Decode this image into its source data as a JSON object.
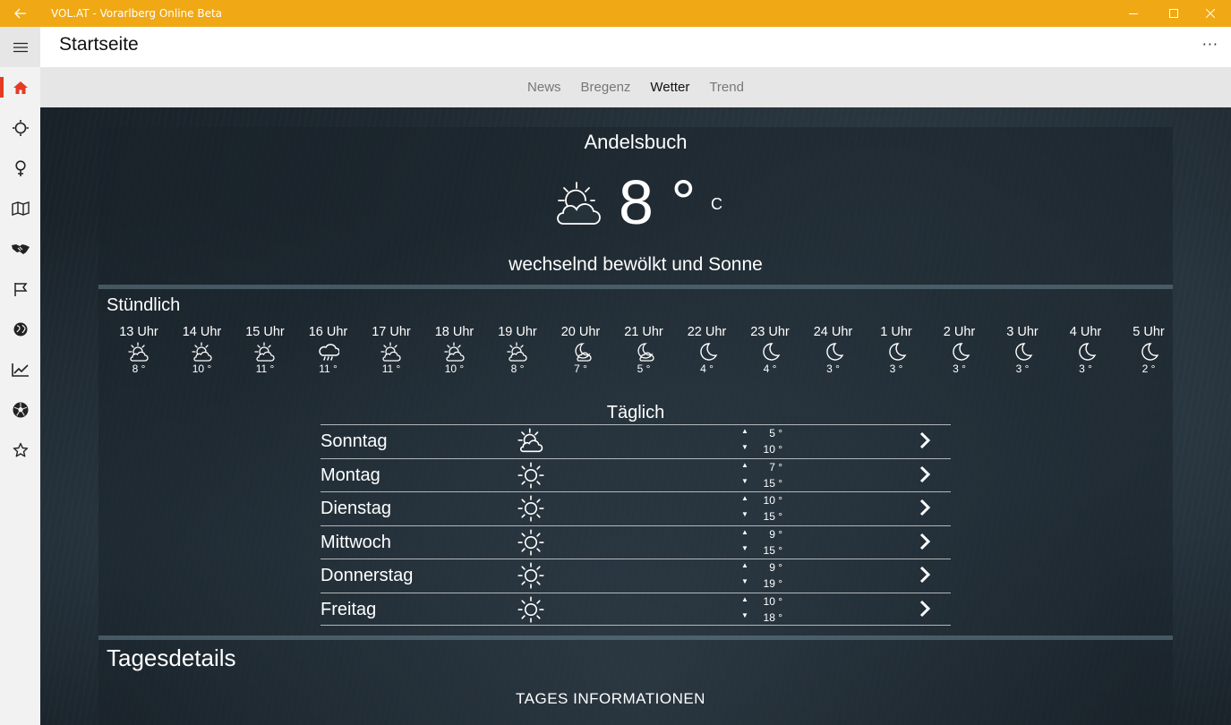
{
  "window": {
    "title": "VOL.AT - Vorarlberg Online Beta"
  },
  "header": {
    "title": "Startseite",
    "more": "···"
  },
  "tabs": [
    {
      "label": "News"
    },
    {
      "label": "Bregenz"
    },
    {
      "label": "Wetter",
      "active": true
    },
    {
      "label": "Trend"
    }
  ],
  "sidebar": {
    "items": [
      {
        "icon": "home-icon",
        "active": true
      },
      {
        "icon": "sun-icon"
      },
      {
        "icon": "female-icon"
      },
      {
        "icon": "map-icon"
      },
      {
        "icon": "handshake-icon"
      },
      {
        "icon": "flag-icon"
      },
      {
        "icon": "globe-icon"
      },
      {
        "icon": "chart-icon"
      },
      {
        "icon": "soccer-icon"
      },
      {
        "icon": "star-icon"
      }
    ]
  },
  "weather": {
    "location": "Andelsbuch",
    "temperature": "8 °",
    "unit": "C",
    "condition": "wechselnd bewölkt und Sonne",
    "current_icon": "partly-cloudy-sun-icon",
    "hourly_title": "Stündlich",
    "hourly": [
      {
        "time": "13 Uhr",
        "temp": "8 °",
        "icon": "partly-cloudy-sun-icon"
      },
      {
        "time": "14 Uhr",
        "temp": "10 °",
        "icon": "partly-cloudy-sun-icon"
      },
      {
        "time": "15 Uhr",
        "temp": "11 °",
        "icon": "partly-cloudy-sun-icon"
      },
      {
        "time": "16 Uhr",
        "temp": "11 °",
        "icon": "rain-cloud-icon"
      },
      {
        "time": "17 Uhr",
        "temp": "11 °",
        "icon": "partly-cloudy-sun-icon"
      },
      {
        "time": "18 Uhr",
        "temp": "10 °",
        "icon": "partly-cloudy-sun-icon"
      },
      {
        "time": "19 Uhr",
        "temp": "8 °",
        "icon": "partly-cloudy-sun-icon"
      },
      {
        "time": "20 Uhr",
        "temp": "7 °",
        "icon": "moon-cloud-icon"
      },
      {
        "time": "21 Uhr",
        "temp": "5 °",
        "icon": "moon-cloud-icon"
      },
      {
        "time": "22 Uhr",
        "temp": "4 °",
        "icon": "moon-icon"
      },
      {
        "time": "23 Uhr",
        "temp": "4 °",
        "icon": "moon-icon"
      },
      {
        "time": "24 Uhr",
        "temp": "3 °",
        "icon": "moon-icon"
      },
      {
        "time": "1 Uhr",
        "temp": "3 °",
        "icon": "moon-icon"
      },
      {
        "time": "2 Uhr",
        "temp": "3 °",
        "icon": "moon-icon"
      },
      {
        "time": "3 Uhr",
        "temp": "3 °",
        "icon": "moon-icon"
      },
      {
        "time": "4 Uhr",
        "temp": "3 °",
        "icon": "moon-icon"
      },
      {
        "time": "5 Uhr",
        "temp": "2 °",
        "icon": "moon-icon"
      }
    ],
    "daily_title": "Täglich",
    "daily": [
      {
        "day": "Sonntag",
        "min": "5 °",
        "max": "10 °",
        "icon": "partly-cloudy-sun-icon"
      },
      {
        "day": "Montag",
        "min": "7 °",
        "max": "15 °",
        "icon": "sun-icon"
      },
      {
        "day": "Dienstag",
        "min": "10 °",
        "max": "15 °",
        "icon": "sun-icon"
      },
      {
        "day": "Mittwoch",
        "min": "9 °",
        "max": "15 °",
        "icon": "sun-icon"
      },
      {
        "day": "Donnerstag",
        "min": "9 °",
        "max": "19 °",
        "icon": "sun-icon"
      },
      {
        "day": "Freitag",
        "min": "10 °",
        "max": "18 °",
        "icon": "sun-icon"
      }
    ],
    "details_title": "Tagesdetails",
    "info_title": "TAGES INFORMATIONEN"
  }
}
